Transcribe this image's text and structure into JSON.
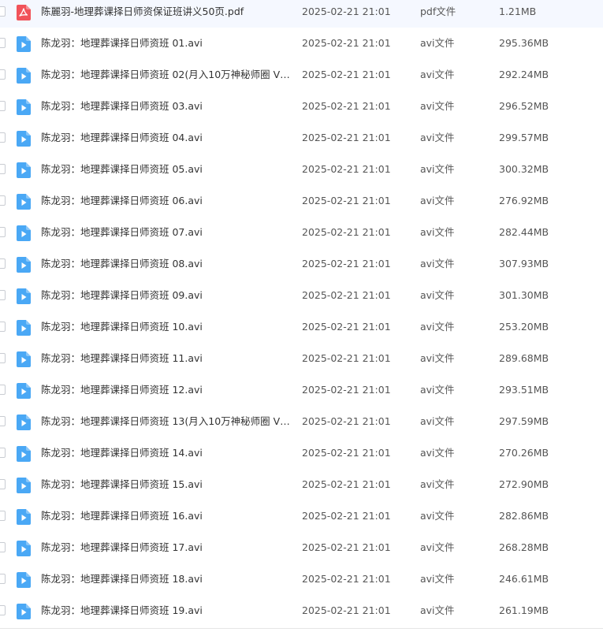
{
  "colors": {
    "pdf_icon": "#f1535a",
    "video_icon": "#4aa8f5",
    "text_primary": "#333333",
    "text_secondary": "#555555"
  },
  "files": [
    {
      "name": "陈麗羽-地理葬课择日师资保证班讲义50页.pdf",
      "modified": "2025-02-21 21:01",
      "type": "pdf文件",
      "size": "1.21MB",
      "icon": "pdf-icon"
    },
    {
      "name": "陈龙羽：地理葬课择日师资班 01.avi",
      "modified": "2025-02-21 21:01",
      "type": "avi文件",
      "size": "295.36MB",
      "icon": "video-icon"
    },
    {
      "name": "陈龙羽：地理葬课择日师资班 02(月入10万神秘师圈 V信...",
      "modified": "2025-02-21 21:01",
      "type": "avi文件",
      "size": "292.24MB",
      "icon": "video-icon"
    },
    {
      "name": "陈龙羽：地理葬课择日师资班 03.avi",
      "modified": "2025-02-21 21:01",
      "type": "avi文件",
      "size": "296.52MB",
      "icon": "video-icon"
    },
    {
      "name": "陈龙羽：地理葬课择日师资班 04.avi",
      "modified": "2025-02-21 21:01",
      "type": "avi文件",
      "size": "299.57MB",
      "icon": "video-icon"
    },
    {
      "name": "陈龙羽：地理葬课择日师资班 05.avi",
      "modified": "2025-02-21 21:01",
      "type": "avi文件",
      "size": "300.32MB",
      "icon": "video-icon"
    },
    {
      "name": "陈龙羽：地理葬课择日师资班 06.avi",
      "modified": "2025-02-21 21:01",
      "type": "avi文件",
      "size": "276.92MB",
      "icon": "video-icon"
    },
    {
      "name": "陈龙羽：地理葬课择日师资班 07.avi",
      "modified": "2025-02-21 21:01",
      "type": "avi文件",
      "size": "282.44MB",
      "icon": "video-icon"
    },
    {
      "name": "陈龙羽：地理葬课择日师资班 08.avi",
      "modified": "2025-02-21 21:01",
      "type": "avi文件",
      "size": "307.93MB",
      "icon": "video-icon"
    },
    {
      "name": "陈龙羽：地理葬课择日师资班 09.avi",
      "modified": "2025-02-21 21:01",
      "type": "avi文件",
      "size": "301.30MB",
      "icon": "video-icon"
    },
    {
      "name": "陈龙羽：地理葬课择日师资班 10.avi",
      "modified": "2025-02-21 21:01",
      "type": "avi文件",
      "size": "253.20MB",
      "icon": "video-icon"
    },
    {
      "name": "陈龙羽：地理葬课择日师资班 11.avi",
      "modified": "2025-02-21 21:01",
      "type": "avi文件",
      "size": "289.68MB",
      "icon": "video-icon"
    },
    {
      "name": "陈龙羽：地理葬课择日师资班 12.avi",
      "modified": "2025-02-21 21:01",
      "type": "avi文件",
      "size": "293.51MB",
      "icon": "video-icon"
    },
    {
      "name": "陈龙羽：地理葬课择日师资班 13(月入10万神秘师圈 V信...",
      "modified": "2025-02-21 21:01",
      "type": "avi文件",
      "size": "297.59MB",
      "icon": "video-icon"
    },
    {
      "name": "陈龙羽：地理葬课择日师资班 14.avi",
      "modified": "2025-02-21 21:01",
      "type": "avi文件",
      "size": "270.26MB",
      "icon": "video-icon"
    },
    {
      "name": "陈龙羽：地理葬课择日师资班 15.avi",
      "modified": "2025-02-21 21:01",
      "type": "avi文件",
      "size": "272.90MB",
      "icon": "video-icon"
    },
    {
      "name": "陈龙羽：地理葬课择日师资班 16.avi",
      "modified": "2025-02-21 21:01",
      "type": "avi文件",
      "size": "282.86MB",
      "icon": "video-icon"
    },
    {
      "name": "陈龙羽：地理葬课择日师资班 17.avi",
      "modified": "2025-02-21 21:01",
      "type": "avi文件",
      "size": "268.28MB",
      "icon": "video-icon"
    },
    {
      "name": "陈龙羽：地理葬课择日师资班 18.avi",
      "modified": "2025-02-21 21:01",
      "type": "avi文件",
      "size": "246.61MB",
      "icon": "video-icon"
    },
    {
      "name": "陈龙羽：地理葬课择日师资班 19.avi",
      "modified": "2025-02-21 21:01",
      "type": "avi文件",
      "size": "261.19MB",
      "icon": "video-icon"
    }
  ]
}
